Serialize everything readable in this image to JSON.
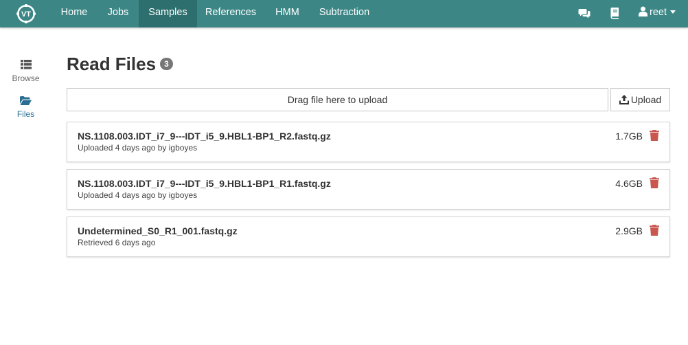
{
  "brand": {
    "logo_text": "VT"
  },
  "nav": {
    "items": [
      {
        "label": "Home"
      },
      {
        "label": "Jobs"
      },
      {
        "label": "Samples"
      },
      {
        "label": "References"
      },
      {
        "label": "HMM"
      },
      {
        "label": "Subtraction"
      }
    ],
    "active": "Samples",
    "right": {
      "icons": [
        "chat-icon",
        "book-icon",
        "user-icon"
      ],
      "username": "reet"
    }
  },
  "sidebar": {
    "items": [
      {
        "label": "Browse",
        "icon": "list-icon"
      },
      {
        "label": "Files",
        "icon": "folder-open-icon",
        "active": true
      }
    ]
  },
  "page": {
    "title": "Read Files",
    "count": "3"
  },
  "upload": {
    "dropzone_text": "Drag file here to upload",
    "button_label": "Upload"
  },
  "files": [
    {
      "name": "NS.1108.003.IDT_i7_9---IDT_i5_9.HBL1-BP1_R2.fastq.gz",
      "meta": "Uploaded 4 days ago by igboyes",
      "size": "1.7GB"
    },
    {
      "name": "NS.1108.003.IDT_i7_9---IDT_i5_9.HBL1-BP1_R1.fastq.gz",
      "meta": "Uploaded 4 days ago by igboyes",
      "size": "4.6GB"
    },
    {
      "name": "Undetermined_S0_R1_001.fastq.gz",
      "meta": "Retrieved 6 days ago",
      "size": "2.9GB"
    }
  ],
  "colors": {
    "navbar": "#3c8786",
    "nav_active": "#2d6f6e",
    "trash": "#c9574f",
    "sidebar_active": "#2a6f93"
  }
}
